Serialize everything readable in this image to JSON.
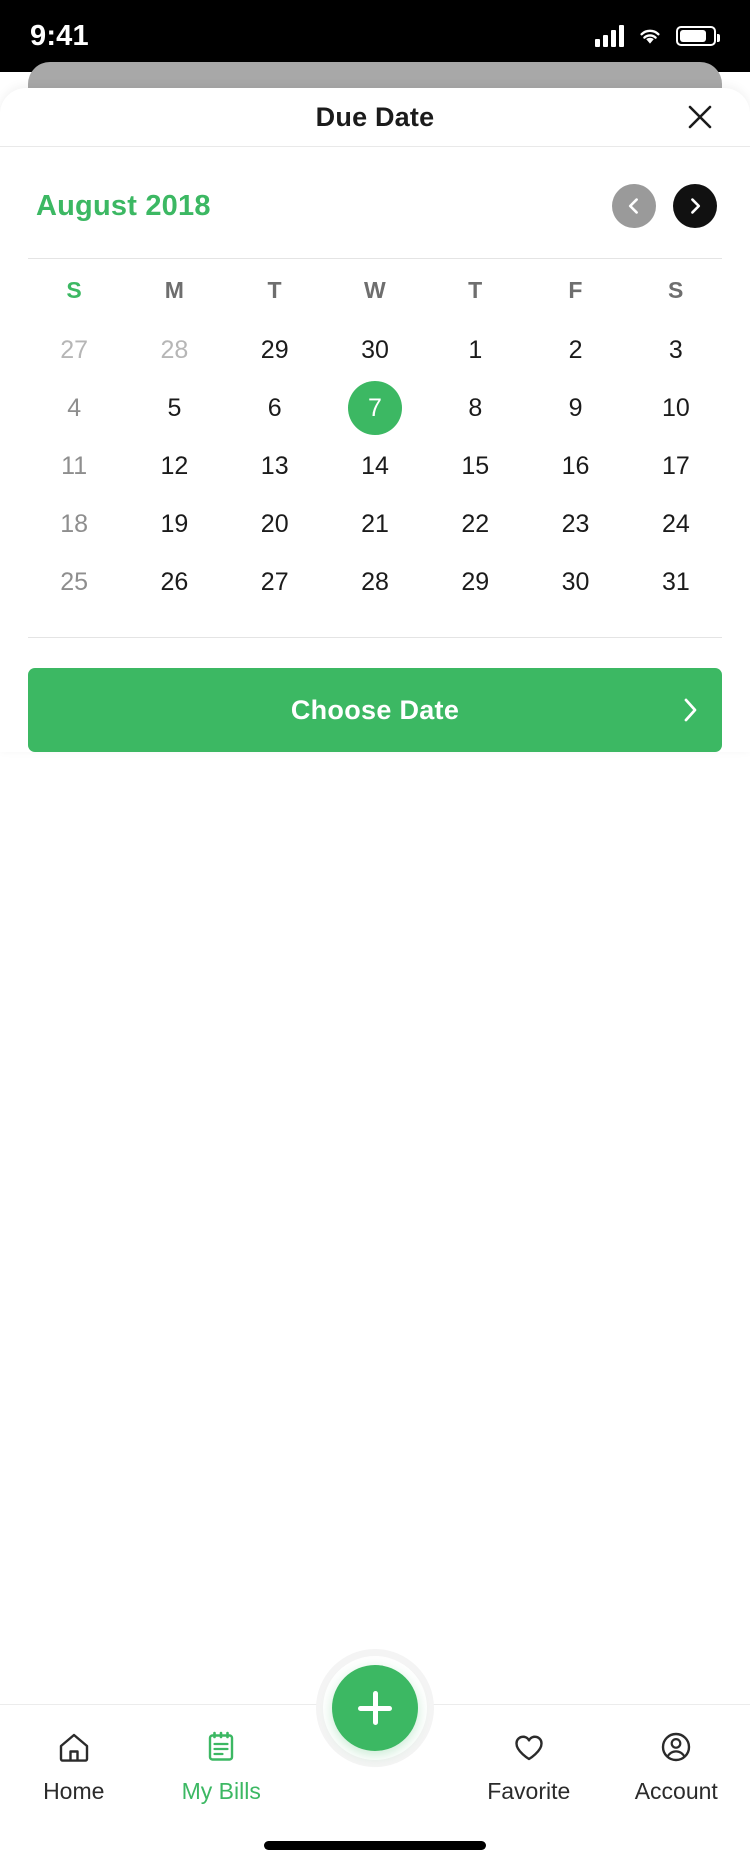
{
  "status_bar": {
    "time": "9:41",
    "icons": [
      "cellular-signal-icon",
      "wifi-icon",
      "battery-icon"
    ]
  },
  "sheet": {
    "title": "Due Date",
    "close_icon": "close-icon"
  },
  "calendar": {
    "month_label": "August 2018",
    "prev_icon": "chevron-left-icon",
    "next_icon": "chevron-right-icon",
    "weekdays": [
      "S",
      "M",
      "T",
      "W",
      "T",
      "F",
      "S"
    ],
    "selected_day": 7,
    "weeks": [
      [
        {
          "label": "27",
          "state": "outside"
        },
        {
          "label": "28",
          "state": "outside"
        },
        {
          "label": "29",
          "state": "normal"
        },
        {
          "label": "30",
          "state": "normal"
        },
        {
          "label": "1",
          "state": "normal"
        },
        {
          "label": "2",
          "state": "normal"
        },
        {
          "label": "3",
          "state": "normal"
        }
      ],
      [
        {
          "label": "4",
          "state": "sunday"
        },
        {
          "label": "5",
          "state": "normal"
        },
        {
          "label": "6",
          "state": "normal"
        },
        {
          "label": "7",
          "state": "selected"
        },
        {
          "label": "8",
          "state": "normal"
        },
        {
          "label": "9",
          "state": "normal"
        },
        {
          "label": "10",
          "state": "normal"
        }
      ],
      [
        {
          "label": "11",
          "state": "sunday"
        },
        {
          "label": "12",
          "state": "normal"
        },
        {
          "label": "13",
          "state": "normal"
        },
        {
          "label": "14",
          "state": "normal"
        },
        {
          "label": "15",
          "state": "normal"
        },
        {
          "label": "16",
          "state": "normal"
        },
        {
          "label": "17",
          "state": "normal"
        }
      ],
      [
        {
          "label": "18",
          "state": "sunday"
        },
        {
          "label": "19",
          "state": "normal"
        },
        {
          "label": "20",
          "state": "normal"
        },
        {
          "label": "21",
          "state": "normal"
        },
        {
          "label": "22",
          "state": "normal"
        },
        {
          "label": "23",
          "state": "normal"
        },
        {
          "label": "24",
          "state": "normal"
        }
      ],
      [
        {
          "label": "25",
          "state": "sunday"
        },
        {
          "label": "26",
          "state": "normal"
        },
        {
          "label": "27",
          "state": "normal"
        },
        {
          "label": "28",
          "state": "normal"
        },
        {
          "label": "29",
          "state": "normal"
        },
        {
          "label": "30",
          "state": "normal"
        },
        {
          "label": "31",
          "state": "normal"
        }
      ]
    ]
  },
  "primary_action": {
    "label": "Choose Date",
    "chevron_icon": "chevron-right-icon"
  },
  "bottom_nav": {
    "items": [
      {
        "label": "Home",
        "icon": "home-icon",
        "active": false
      },
      {
        "label": "My Bills",
        "icon": "bills-icon",
        "active": true
      },
      {
        "label": "Favorite",
        "icon": "heart-icon",
        "active": false
      },
      {
        "label": "Account",
        "icon": "account-circle-icon",
        "active": false
      }
    ],
    "fab": {
      "icon": "plus-icon",
      "label": "Add"
    }
  },
  "colors": {
    "accent_green": "#3CB863",
    "status_bar_bg": "#000000",
    "text_primary": "#1B1B1B",
    "text_muted": "#B6B6B6",
    "divider": "#E4E4E4"
  }
}
